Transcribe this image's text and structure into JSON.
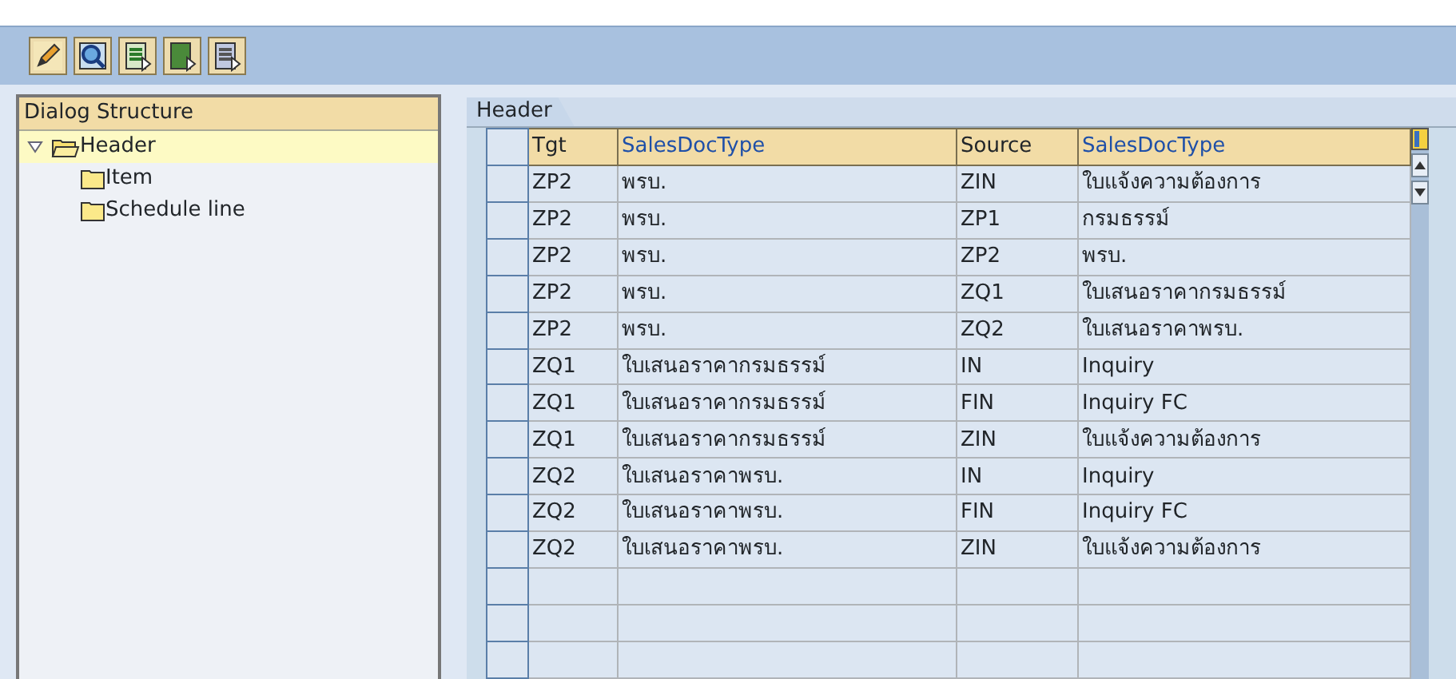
{
  "toolbar": {
    "buttons": [
      {
        "kind": "edit"
      },
      {
        "kind": "find"
      },
      {
        "kind": "select-all"
      },
      {
        "kind": "select-block"
      },
      {
        "kind": "deselect"
      }
    ]
  },
  "dialog_structure": {
    "title": "Dialog Structure",
    "items": [
      {
        "label": "Header",
        "expanded": true,
        "selected": true,
        "children": [
          {
            "label": "Item",
            "selected": false
          },
          {
            "label": "Schedule line",
            "selected": false
          }
        ]
      }
    ]
  },
  "table": {
    "tab": "Header",
    "columns": [
      {
        "label": "Tgt",
        "kind": "key"
      },
      {
        "label": "SalesDocType",
        "kind": "text"
      },
      {
        "label": "Source",
        "kind": "key"
      },
      {
        "label": "SalesDocType",
        "kind": "text"
      }
    ],
    "rows": [
      [
        "ZP2",
        "พรบ.",
        "ZIN",
        "ใบแจ้งความต้องการ"
      ],
      [
        "ZP2",
        "พรบ.",
        "ZP1",
        "กรมธรรม์"
      ],
      [
        "ZP2",
        "พรบ.",
        "ZP2",
        "พรบ."
      ],
      [
        "ZP2",
        "พรบ.",
        "ZQ1",
        "ใบเสนอราคากรมธรรม์"
      ],
      [
        "ZP2",
        "พรบ.",
        "ZQ2",
        "ใบเสนอราคาพรบ."
      ],
      [
        "ZQ1",
        "ใบเสนอราคากรมธรรม์",
        "IN",
        "Inquiry"
      ],
      [
        "ZQ1",
        "ใบเสนอราคากรมธรรม์",
        "FIN",
        "Inquiry FC"
      ],
      [
        "ZQ1",
        "ใบเสนอราคากรมธรรม์",
        "ZIN",
        "ใบแจ้งความต้องการ"
      ],
      [
        "ZQ2",
        "ใบเสนอราคาพรบ.",
        "IN",
        "Inquiry"
      ],
      [
        "ZQ2",
        "ใบเสนอราคาพรบ.",
        "FIN",
        "Inquiry FC"
      ],
      [
        "ZQ2",
        "ใบเสนอราคาพรบ.",
        "ZIN",
        "ใบแจ้งความต้องการ"
      ]
    ]
  }
}
